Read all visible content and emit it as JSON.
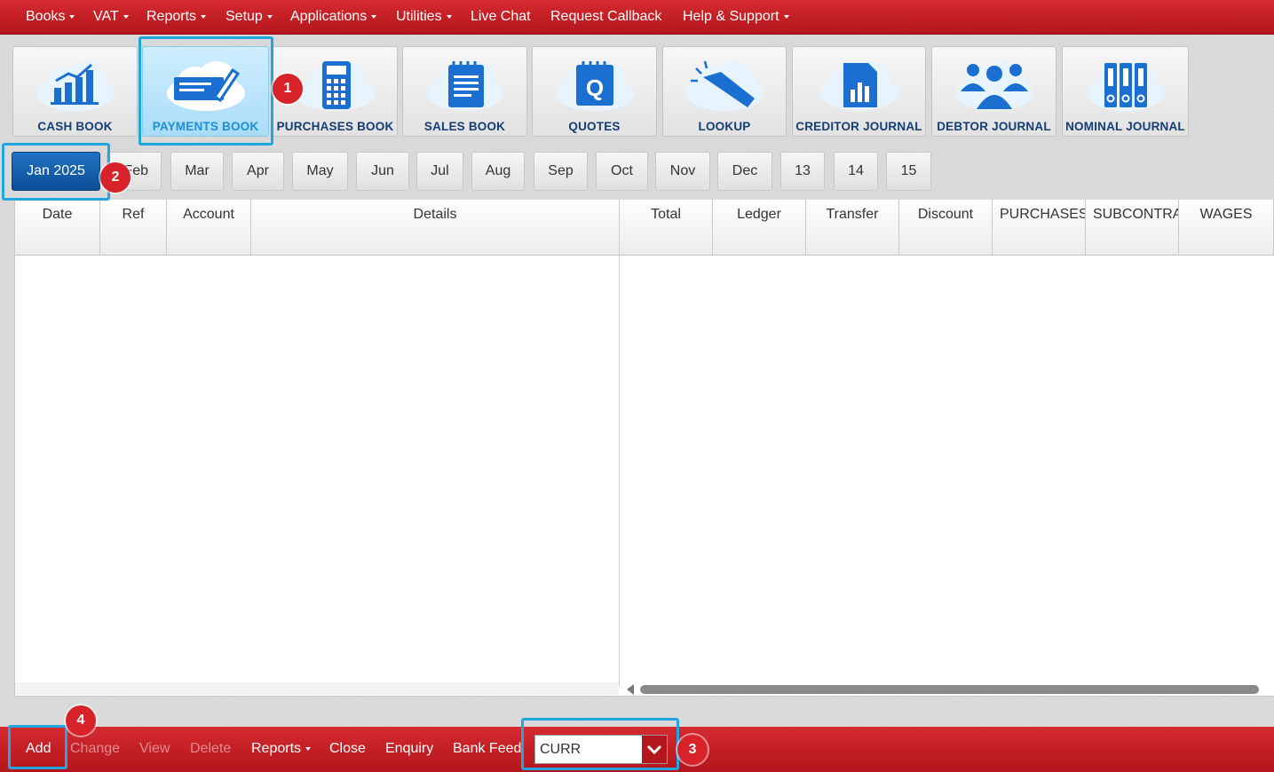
{
  "top_menu": [
    {
      "label": "Books",
      "dropdown": true
    },
    {
      "label": "VAT",
      "dropdown": true
    },
    {
      "label": "Reports",
      "dropdown": true
    },
    {
      "label": "Setup",
      "dropdown": true
    },
    {
      "label": "Applications",
      "dropdown": true
    },
    {
      "label": "Utilities",
      "dropdown": true
    },
    {
      "label": "Live Chat",
      "dropdown": false
    },
    {
      "label": "Request Callback",
      "dropdown": false
    },
    {
      "label": "Help & Support",
      "dropdown": true
    }
  ],
  "books": [
    {
      "label": "CASH BOOK",
      "icon": "bar-chart-icon",
      "active": false
    },
    {
      "label": "PAYMENTS BOOK",
      "icon": "cheque-pen-icon",
      "active": true
    },
    {
      "label": "PURCHASES BOOK",
      "icon": "calculator-icon",
      "active": false
    },
    {
      "label": "SALES BOOK",
      "icon": "notepad-icon",
      "active": false
    },
    {
      "label": "QUOTES",
      "icon": "quote-pad-icon",
      "active": false
    },
    {
      "label": "LOOKUP",
      "icon": "flashlight-icon",
      "active": false
    },
    {
      "label": "CREDITOR JOURNAL",
      "icon": "document-chart-icon",
      "active": false
    },
    {
      "label": "DEBTOR JOURNAL",
      "icon": "people-icon",
      "active": false
    },
    {
      "label": "NOMINAL JOURNAL",
      "icon": "binders-icon",
      "active": false
    }
  ],
  "months": [
    "Jan 2025",
    "Feb",
    "Mar",
    "Apr",
    "May",
    "Jun",
    "Jul",
    "Aug",
    "Sep",
    "Oct",
    "Nov",
    "Dec",
    "13",
    "14",
    "15"
  ],
  "active_month": "Jan 2025",
  "columns": [
    "Date",
    "Ref",
    "Account",
    "Details",
    "Total",
    "Ledger",
    "Transfer",
    "Discount",
    "PURCHASES",
    "SUBCONTRA",
    "WAGES"
  ],
  "bottom_actions": [
    {
      "label": "Add",
      "enabled": true
    },
    {
      "label": "Change",
      "enabled": false
    },
    {
      "label": "View",
      "enabled": false
    },
    {
      "label": "Delete",
      "enabled": false
    },
    {
      "label": "Reports",
      "enabled": true,
      "dropdown": true
    },
    {
      "label": "Close",
      "enabled": true
    },
    {
      "label": "Enquiry",
      "enabled": true
    },
    {
      "label": "Bank Feed",
      "enabled": true
    }
  ],
  "currency_select": {
    "value": "CURR"
  },
  "annotations": [
    "1",
    "2",
    "3",
    "4"
  ],
  "colors": {
    "brand_red": "#c41e24",
    "highlight": "#22a6e0",
    "active_blue": "#0c4e97",
    "icon_blue": "#1a6fd0"
  }
}
